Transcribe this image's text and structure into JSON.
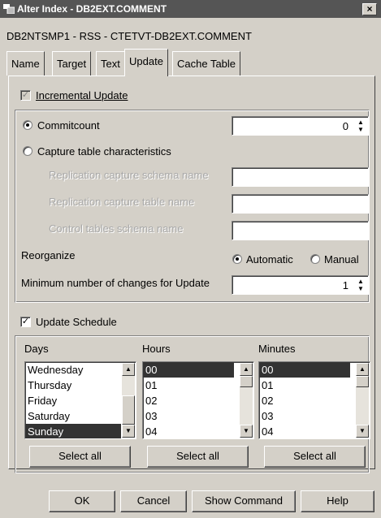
{
  "window": {
    "title": "Alter Index - DB2EXT.COMMENT",
    "close_label": "×"
  },
  "subtitle": "DB2NTSMP1 - RSS - CTETVT-DB2EXT.COMMENT",
  "tabs": [
    "Name",
    "Target",
    "Text",
    "Update",
    "Cache Table"
  ],
  "active_tab": "Update",
  "incremental_update": {
    "label": "Incremental Update",
    "checked": true,
    "enabled": false
  },
  "commitcount": {
    "label": "Commitcount",
    "value": "0",
    "selected": true
  },
  "capture_table": {
    "label": "Capture table characteristics",
    "selected": false,
    "fields": [
      {
        "label": "Replication capture schema name",
        "value": ""
      },
      {
        "label": "Replication capture table name",
        "value": ""
      },
      {
        "label": "Control tables schema name",
        "value": ""
      }
    ]
  },
  "reorganize": {
    "label": "Reorganize",
    "options": [
      {
        "label": "Automatic",
        "selected": true
      },
      {
        "label": "Manual",
        "selected": false
      }
    ]
  },
  "min_changes": {
    "label": "Minimum number of changes for Update",
    "value": "1"
  },
  "update_schedule": {
    "label": "Update Schedule",
    "checked": true,
    "days": {
      "header": "Days",
      "items": [
        "Wednesday",
        "Thursday",
        "Friday",
        "Saturday",
        "Sunday"
      ],
      "selected": "Sunday",
      "select_all_label": "Select all"
    },
    "hours": {
      "header": "Hours",
      "items": [
        "00",
        "01",
        "02",
        "03",
        "04"
      ],
      "selected": "00",
      "select_all_label": "Select all"
    },
    "minutes": {
      "header": "Minutes",
      "items": [
        "00",
        "01",
        "02",
        "03",
        "04"
      ],
      "selected": "00",
      "select_all_label": "Select all"
    }
  },
  "footer": {
    "ok": "OK",
    "cancel": "Cancel",
    "show_command": "Show Command",
    "help": "Help"
  },
  "colors": {
    "face": "#d4d0c8",
    "titlebar": "#555555",
    "selection": "#333333"
  }
}
